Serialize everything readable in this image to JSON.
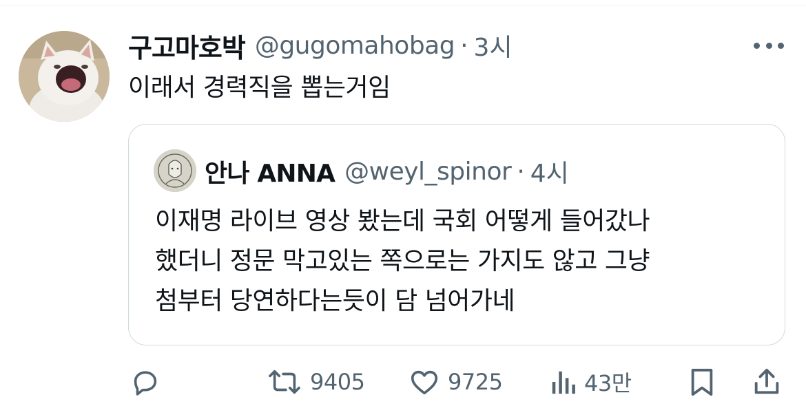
{
  "tweet": {
    "author_name": "구고마호박",
    "author_handle": "@gugomahobag",
    "separator": "·",
    "time": "3시",
    "text": "이래서 경력직을 뽑는거임"
  },
  "quote": {
    "author_name": "안나 ANNA",
    "author_handle": "@weyl_spinor",
    "separator": "·",
    "time": "4시",
    "lines": [
      "이재명 라이브 영상 봤는데 국회 어떻게 들어갔나",
      "했더니 정문 막고있는 쪽으로는 가지도 않고 그냥",
      "첨부터 당연하다는듯이 담 넘어가네"
    ]
  },
  "actions": {
    "reply": {
      "icon": "reply-icon",
      "count": ""
    },
    "retweet": {
      "icon": "retweet-icon",
      "count": "9405"
    },
    "like": {
      "icon": "heart-icon",
      "count": "9725"
    },
    "views": {
      "icon": "views-icon",
      "count": "43만"
    },
    "bookmark": {
      "icon": "bookmark-icon"
    },
    "share": {
      "icon": "share-icon"
    }
  },
  "colors": {
    "text": "#0f1419",
    "secondary": "#536471",
    "border": "#cfd9de"
  }
}
